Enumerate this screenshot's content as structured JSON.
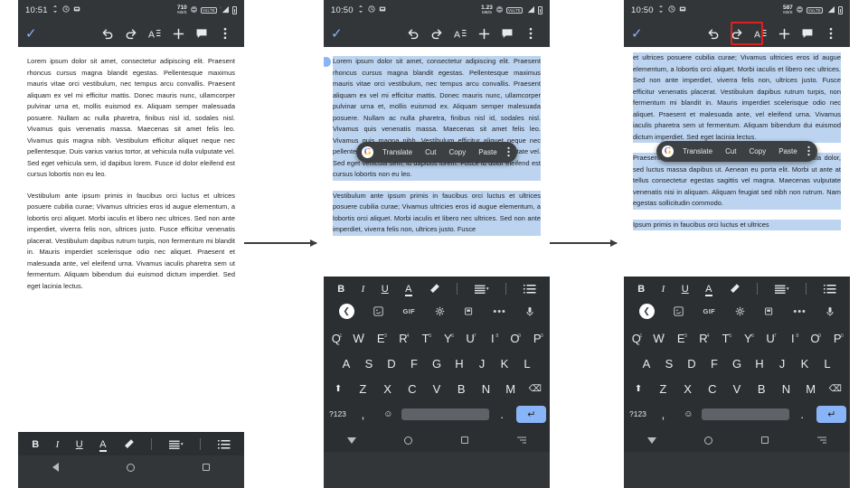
{
  "panels": [
    {
      "id": "panel-1",
      "status": {
        "clock": "10:51",
        "rate_num": "710",
        "rate_unit": "KB/S",
        "volte": "VoLTE"
      },
      "toolbar": {
        "done_label": "✓",
        "undo": "undo-icon",
        "redo": "redo-icon",
        "format": "format-text-icon",
        "add": "add-icon",
        "comment": "comment-icon",
        "overflow": "overflow-menu-icon"
      },
      "paragraphs": [
        "Lorem ipsum dolor sit amet, consectetur adipiscing elit. Praesent rhoncus cursus magna blandit egestas. Pellentesque maximus mauris vitae orci vestibulum, nec tempus arcu convallis. Praesent aliquam ex vel mi efficitur mattis. Donec mauris nunc, ullamcorper pulvinar urna et, mollis euismod ex. Aliquam semper malesuada posuere. Nullam ac nulla pharetra, finibus nisl id, sodales nisl. Vivamus quis venenatis massa. Maecenas sit amet felis leo. Vivamus quis magna nibh. Vestibulum efficitur aliquet neque nec pellentesque. Duis varius varius tortor, at vehicula nulla vulputate vel. Sed eget vehicula sem, id dapibus lorem. Fusce id dolor eleifend est cursus lobortis non eu leo.",
        "Vestibulum ante ipsum primis in faucibus orci luctus et ultrices posuere cubilia curae; Vivamus ultricies eros id augue elementum, a lobortis orci aliquet. Morbi iaculis et libero nec ultrices. Sed non ante imperdiet, viverra felis non, ultrices justo. Fusce efficitur venenatis placerat. Vestibulum dapibus rutrum turpis, non fermentum mi blandit in. Mauris imperdiet scelerisque odio nec aliquet. Praesent et malesuada ante, vel eleifend urna. Vivamus iaculis pharetra sem ut fermentum. Aliquam bibendum dui euismod dictum imperdiet. Sed eget lacinia lectus."
      ],
      "selected": false,
      "context_menu": null,
      "keyboard": false,
      "highlight_format_button": false
    },
    {
      "id": "panel-2",
      "status": {
        "clock": "10:50",
        "rate_num": "1.23",
        "rate_unit": "MB/S",
        "volte": "VoLTE"
      },
      "toolbar": {
        "done_label": "✓",
        "undo": "undo-icon",
        "redo": "redo-icon",
        "format": "format-text-icon",
        "add": "add-icon",
        "comment": "comment-icon",
        "overflow": "overflow-menu-icon"
      },
      "paragraphs": [
        "Lorem ipsum dolor sit amet, consectetur adipiscing elit. Praesent rhoncus cursus magna blandit egestas. Pellentesque maximus mauris vitae orci vestibulum, nec tempus arcu convallis. Praesent aliquam ex vel mi efficitur mattis. Donec mauris nunc, ullamcorper pulvinar urna et, mollis euismod ex. Aliquam semper malesuada posuere. Nullam ac nulla pharetra, finibus nisl id, sodales nisl. Vivamus quis venenatis massa. Maecenas sit amet felis leo. Vivamus quis magna nibh. Vestibulum efficitur aliquet neque nec pellentesque. Duis varius varius tortor, at vehicula nulla vulputate vel. Sed eget vehicula sem, id dapibus lorem. Fusce id dolor eleifend est cursus lobortis non eu leo.",
        "Vestibulum ante ipsum primis in faucibus orci luctus et ultrices posuere cubilia curae; Vivamus ultricies eros id augue elementum, a lobortis orci aliquet. Morbi iaculis et libero nec ultrices. Sed non ante imperdiet, viverra felis non, ultrices justo. Fusce"
      ],
      "selected": true,
      "context_menu": {
        "translate": "Translate",
        "cut": "Cut",
        "copy": "Copy",
        "paste": "Paste",
        "overflow": "overflow-menu-icon",
        "google_letter": "G"
      },
      "keyboard": true,
      "highlight_format_button": false
    },
    {
      "id": "panel-3",
      "status": {
        "clock": "10:50",
        "rate_num": "587",
        "rate_unit": "KB/S",
        "volte": "VoLTE"
      },
      "toolbar": {
        "done_label": "✓",
        "undo": "undo-icon",
        "redo": "redo-icon",
        "format": "format-text-icon",
        "add": "add-icon",
        "comment": "comment-icon",
        "overflow": "overflow-menu-icon"
      },
      "paragraphs": [
        "et ultrices posuere cubilia curae; Vivamus ultricies eros id augue elementum, a lobortis orci aliquet. Morbi iaculis et libero nec ultrices. Sed non ante imperdiet, viverra felis non, ultrices justo. Fusce efficitur venenatis placerat. Vestibulum dapibus rutrum turpis, non fermentum mi blandit in. Mauris imperdiet scelerisque odio nec aliquet. Praesent et malesuada ante, vel eleifend urna. Vivamus iaculis pharetra sem ut fermentum. Aliquam bibendum dui euismod dictum imperdiet. Sed eget lacinia lectus.",
        "Praesent vitae pretium augue. Praesent malesuada vehicula dolor, sed luctus massa dapibus ut. Aenean eu porta elit. Morbi ut ante at tellus consectetur egestas sagittis vel magna. Maecenas vulputate venenatis nisi in aliquam. Aliquam feugiat sed nibh non rutrum. Nam egestas sollicitudin commodo.",
        "Ipsum primis in faucibus orci luctus et ultrices"
      ],
      "selected": true,
      "context_menu": {
        "translate": "Translate",
        "cut": "Cut",
        "copy": "Copy",
        "paste": "Paste",
        "overflow": "overflow-menu-icon",
        "google_letter": "G"
      },
      "keyboard": true,
      "highlight_format_button": true
    }
  ],
  "format_bar": {
    "bold": "B",
    "italic": "I",
    "underline": "U",
    "text_color": "A",
    "highlight": "highlighter-icon",
    "align": "align-icon",
    "list": "bulleted-list-icon"
  },
  "keyboard": {
    "suggest": [
      "back-chevron-icon",
      "sticker-icon",
      "GIF",
      "settings-gear-icon",
      "clipboard-icon",
      "more-dots-icon",
      "microphone-icon"
    ],
    "gif_label": "GIF",
    "row1": [
      {
        "key": "Q",
        "num": "1"
      },
      {
        "key": "W",
        "num": "2"
      },
      {
        "key": "E",
        "num": "3"
      },
      {
        "key": "R",
        "num": "4"
      },
      {
        "key": "T",
        "num": "5"
      },
      {
        "key": "Y",
        "num": "6"
      },
      {
        "key": "U",
        "num": "7"
      },
      {
        "key": "I",
        "num": "8"
      },
      {
        "key": "O",
        "num": "9"
      },
      {
        "key": "P",
        "num": "0"
      }
    ],
    "row2": [
      "A",
      "S",
      "D",
      "F",
      "G",
      "H",
      "J",
      "K",
      "L"
    ],
    "row3": [
      "⬆",
      "Z",
      "X",
      "C",
      "V",
      "B",
      "N",
      "M",
      "⌫"
    ],
    "row4": {
      "numsym": "?123",
      "comma": ",",
      "emoji": "☺",
      "space": "",
      "period": ".",
      "enter": "↵"
    }
  },
  "navbar": {
    "back": "back-triangle-icon",
    "home": "home-circle-icon",
    "recents": "recents-square-icon",
    "keyboard_hide": "keyboard-hide-icon"
  },
  "colors": {
    "accent": "#8ab4f8",
    "chrome": "#323639",
    "keyboard_bg": "#2b2f31",
    "selection": "#bcd4f0",
    "highlight_box": "#e02020"
  },
  "arrows": [
    {
      "name": "arrow-1-to-2"
    },
    {
      "name": "arrow-2-to-3"
    }
  ]
}
